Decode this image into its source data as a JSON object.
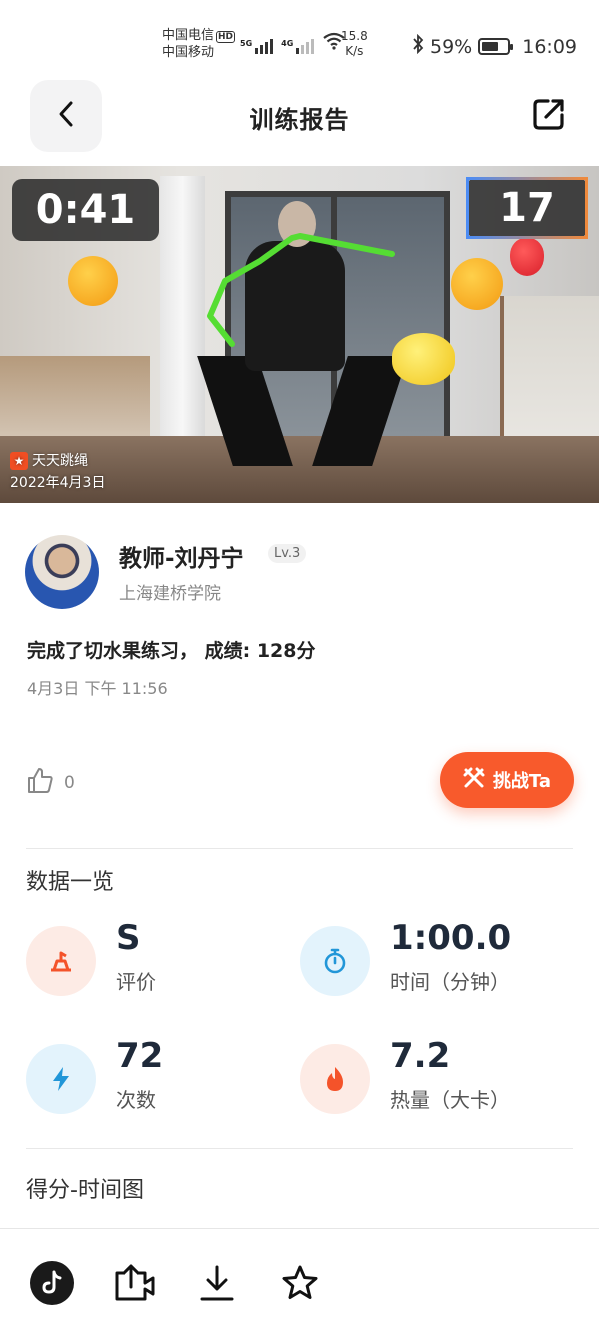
{
  "status_bar": {
    "carrier1": "中国电信",
    "hd": "HD",
    "carrier2": "中国移动",
    "sig1": "5G",
    "sig2": "4G",
    "speed_value": "15.8",
    "speed_unit": "K/s",
    "battery_text": "59%",
    "battery_level": 0.59,
    "time": "16:09"
  },
  "header": {
    "title": "训练报告"
  },
  "video": {
    "timer": "0:41",
    "count": "17",
    "watermark_app": "天天跳绳",
    "watermark_date": "2022年4月3日"
  },
  "profile": {
    "name": "教师-刘丹宁",
    "level": "Lv.3",
    "school": "上海建桥学院",
    "achievement": "完成了切水果练习， 成绩: 128分",
    "time": "4月3日 下午 11:56"
  },
  "actions": {
    "likes": "0",
    "challenge_label": "挑战Ta"
  },
  "overview": {
    "title": "数据一览",
    "stats": [
      {
        "value": "S",
        "label": "评价",
        "icon": "rating-icon",
        "color": "#f4532a",
        "bg": "#fdebe5"
      },
      {
        "value": "1:00.0",
        "label": "时间（分钟）",
        "icon": "stopwatch-icon",
        "color": "#2196d8",
        "bg": "#e3f3fc"
      },
      {
        "value": "72",
        "label": "次数",
        "icon": "lightning-icon",
        "color": "#2196d8",
        "bg": "#e3f3fc"
      },
      {
        "value": "7.2",
        "label": "热量（大卡）",
        "icon": "flame-icon",
        "color": "#f4532a",
        "bg": "#fdebe5"
      }
    ]
  },
  "chart_section": {
    "title": "得分-时间图"
  },
  "bottom_bar": {
    "icons": [
      "tiktok-icon",
      "share-video-icon",
      "download-icon",
      "star-icon"
    ]
  }
}
